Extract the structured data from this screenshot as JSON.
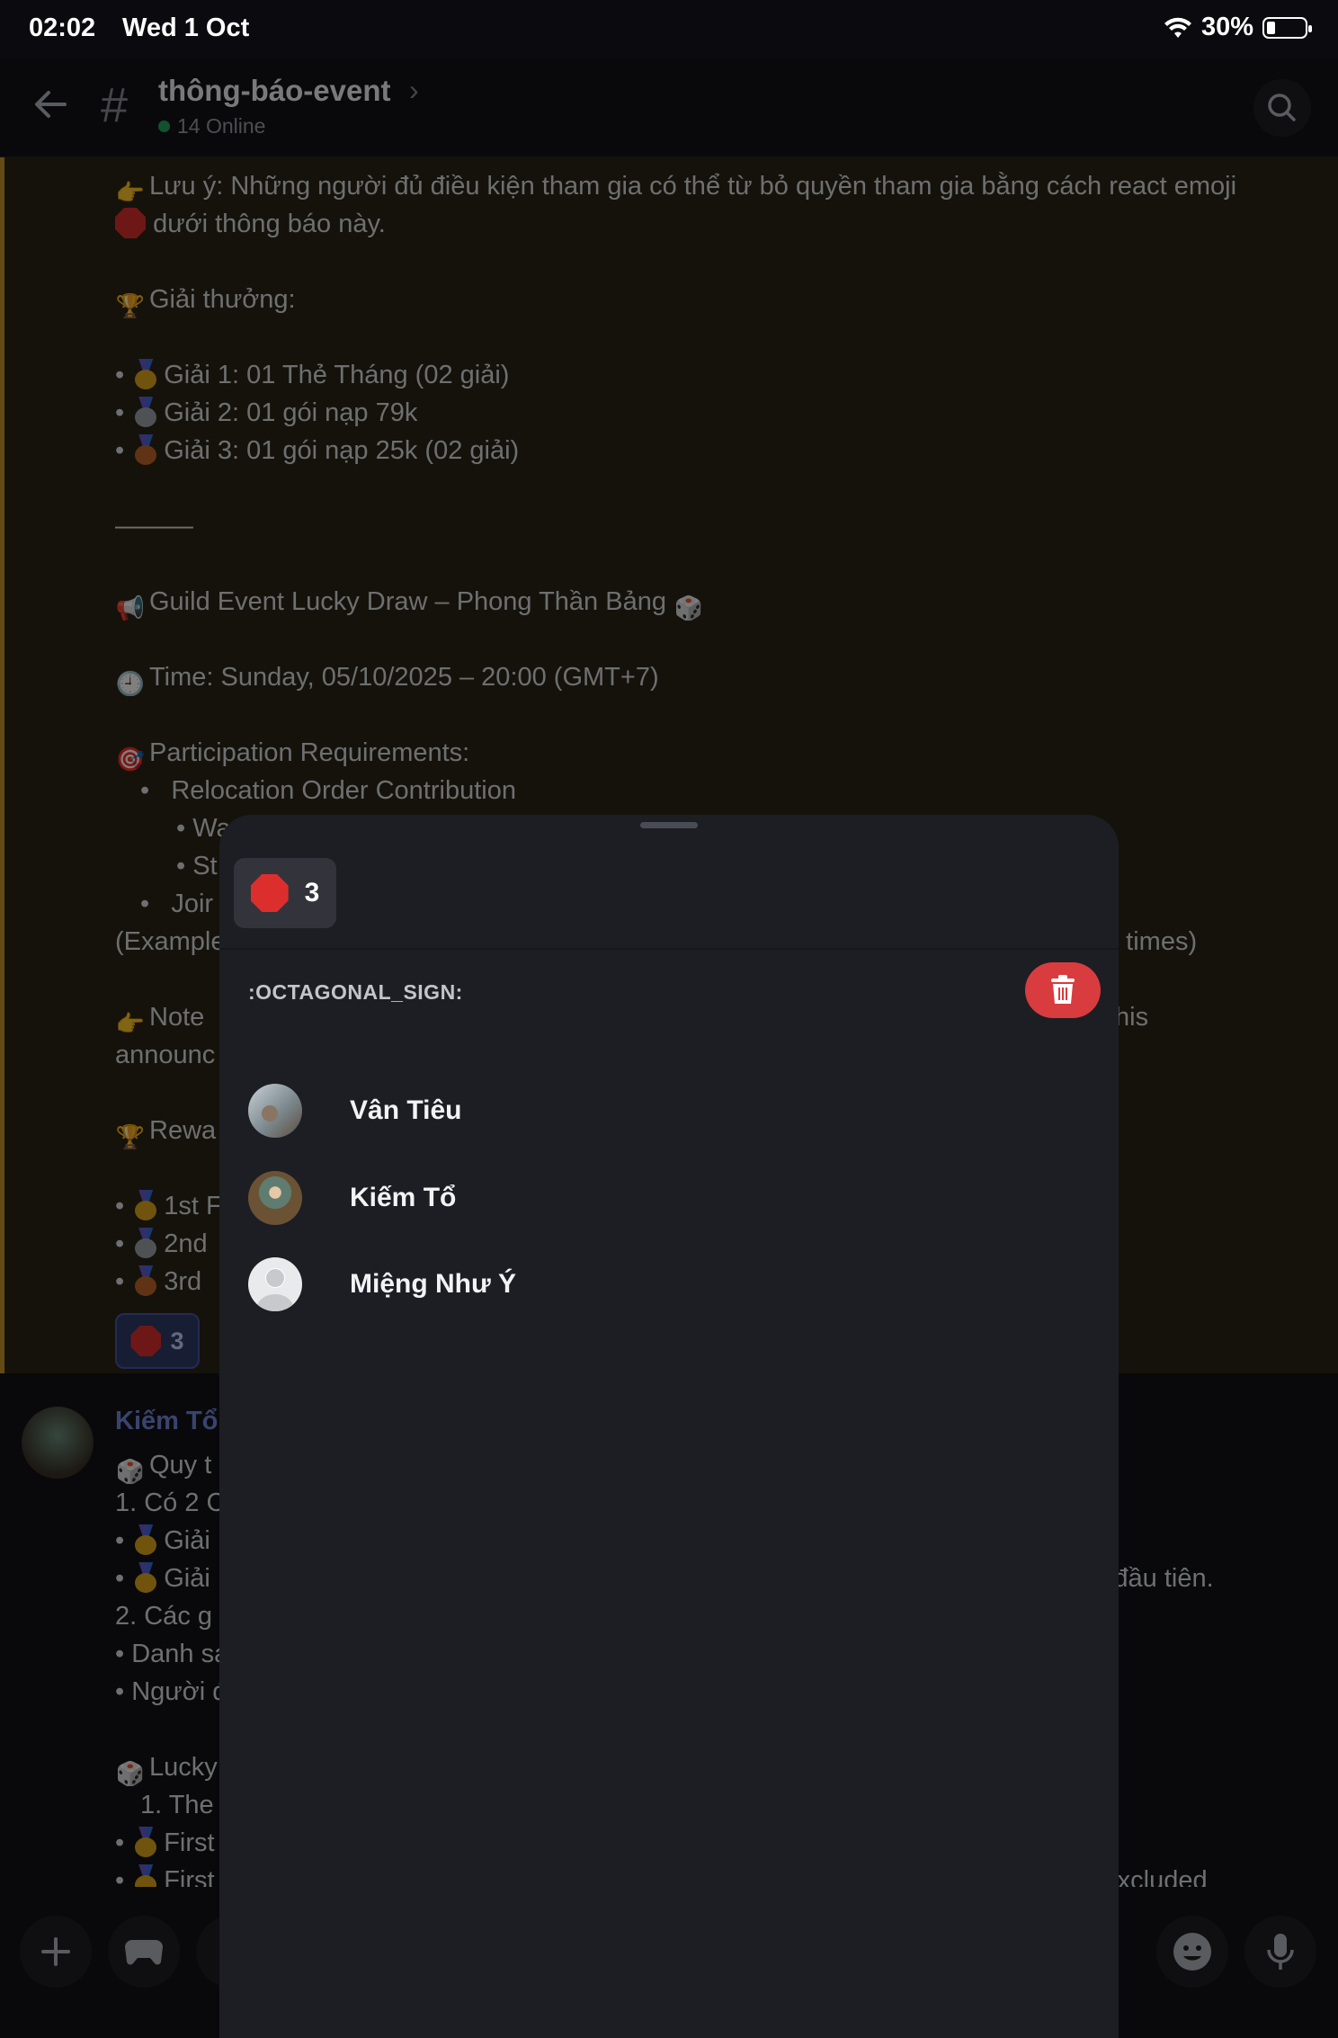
{
  "status": {
    "time": "02:02",
    "date": "Wed 1 Oct",
    "battery": "30%"
  },
  "header": {
    "channel": "thông-báo-event",
    "online": "14 Online"
  },
  "message": {
    "lines": [
      "Lưu ý: Những người đủ điều kiện tham gia có thể từ bỏ quyền tham gia bằng cách react emoji",
      "dưới thông báo này.",
      "",
      "Giải thưởng:",
      "",
      "Giải 1: 01 Thẻ Tháng (02 giải)",
      "Giải 2: 01 gói nạp 79k",
      "Giải 3: 01 gói nạp 25k (02 giải)",
      "",
      "———",
      "",
      "Guild Event Lucky Draw – Phong Thần Bảng",
      "",
      "Time: Sunday, 05/10/2025 – 20:00 (GMT+7)",
      "",
      "Participation Requirements:",
      "Relocation Order Contribution",
      "• Wa",
      "• St",
      "Joir",
      "(Example",
      "",
      "Note",
      "announc",
      "",
      "Rewa",
      "",
      "1st F",
      "2nd",
      "3rd"
    ],
    "right_fragments": {
      "times": "2 times)",
      "his": "his"
    },
    "reaction_count": "3"
  },
  "second": {
    "author": "Kiếm Tổ",
    "lines": [
      "Quy t",
      "1.  Có 2 C",
      "Giải",
      "Giải",
      "2.  Các g",
      "• Danh sa",
      "• Người đ",
      "",
      "Lucky",
      "1.  The",
      "First",
      "First"
    ],
    "right1": "uất đầu tiên.",
    "right2": "s excluded"
  },
  "sheet": {
    "chip_count": "3",
    "emoji_name": ":OCTAGONAL_SIGN:",
    "users": [
      {
        "name": "Vân Tiêu",
        "avatar": "photo-avatar"
      },
      {
        "name": "Kiếm Tổ",
        "avatar": "character-avatar"
      },
      {
        "name": "Miệng Như Ý",
        "avatar": "default-avatar"
      }
    ]
  }
}
